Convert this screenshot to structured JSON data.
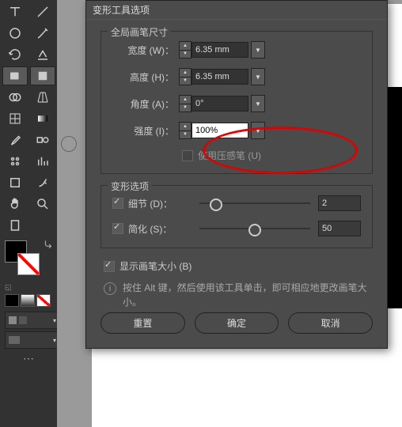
{
  "dialog": {
    "title": "变形工具选项",
    "section1": {
      "title": "全局画笔尺寸",
      "width_label": "宽度 (W)：",
      "width_value": "6.35 mm",
      "height_label": "高度 (H)：",
      "height_value": "6.35 mm",
      "angle_label": "角度 (A)：",
      "angle_value": "0°",
      "intensity_label": "强度 (I)：",
      "intensity_value": "100%",
      "pressure_label": "使用压感笔 (U)"
    },
    "section2": {
      "title": "变形选项",
      "detail_label": "细节 (D)：",
      "detail_value": "2",
      "simplify_label": "简化 (S)：",
      "simplify_value": "50"
    },
    "show_brush_label": "显示画笔大小 (B)",
    "info_text": "按住 Alt 键，然后使用该工具单击，即可相应地更改画笔大小。",
    "buttons": {
      "reset": "重置",
      "ok": "确定",
      "cancel": "取消"
    }
  },
  "colors": {
    "mini1": "#000",
    "mini2": "#888",
    "mini3_a": "#fff",
    "mini3_b": "#f00"
  }
}
